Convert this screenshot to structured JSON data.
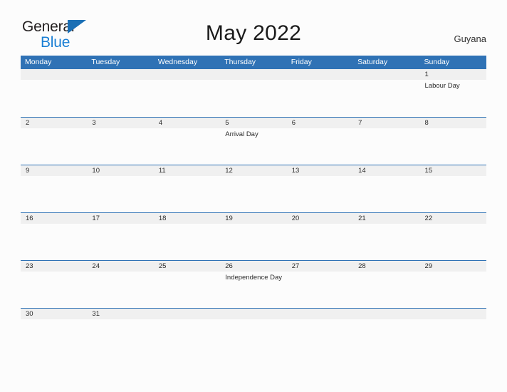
{
  "brand": {
    "word1": "General",
    "word2": "Blue",
    "triangle_color": "#1a6fb5",
    "word2_color": "#1a7fd4"
  },
  "header": {
    "title": "May 2022",
    "country": "Guyana"
  },
  "calendar": {
    "accent_color": "#2f72b5",
    "band_color": "#f0f0f0",
    "weekdays": [
      "Monday",
      "Tuesday",
      "Wednesday",
      "Thursday",
      "Friday",
      "Saturday",
      "Sunday"
    ],
    "weeks": [
      {
        "dates": [
          "",
          "",
          "",
          "",
          "",
          "",
          "1"
        ],
        "events": [
          "",
          "",
          "",
          "",
          "",
          "",
          "Labour Day"
        ]
      },
      {
        "dates": [
          "2",
          "3",
          "4",
          "5",
          "6",
          "7",
          "8"
        ],
        "events": [
          "",
          "",
          "",
          "Arrival Day",
          "",
          "",
          ""
        ]
      },
      {
        "dates": [
          "9",
          "10",
          "11",
          "12",
          "13",
          "14",
          "15"
        ],
        "events": [
          "",
          "",
          "",
          "",
          "",
          "",
          ""
        ]
      },
      {
        "dates": [
          "16",
          "17",
          "18",
          "19",
          "20",
          "21",
          "22"
        ],
        "events": [
          "",
          "",
          "",
          "",
          "",
          "",
          ""
        ]
      },
      {
        "dates": [
          "23",
          "24",
          "25",
          "26",
          "27",
          "28",
          "29"
        ],
        "events": [
          "",
          "",
          "",
          "Independence Day",
          "",
          "",
          ""
        ]
      },
      {
        "dates": [
          "30",
          "31",
          "",
          "",
          "",
          "",
          ""
        ],
        "events": [
          "",
          "",
          "",
          "",
          "",
          "",
          ""
        ]
      }
    ]
  }
}
